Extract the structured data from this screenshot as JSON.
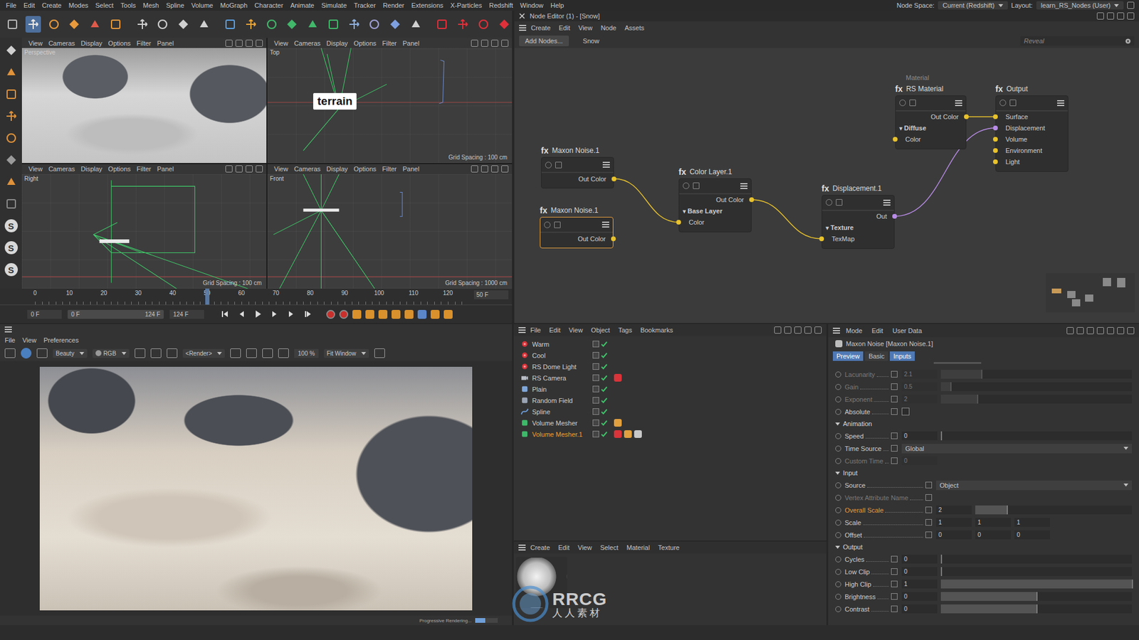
{
  "menubar": {
    "items": [
      "File",
      "Edit",
      "Create",
      "Modes",
      "Select",
      "Tools",
      "Mesh",
      "Spline",
      "Volume",
      "MoGraph",
      "Character",
      "Animate",
      "Simulate",
      "Tracker",
      "Render",
      "Extensions",
      "X-Particles",
      "Redshift",
      "Window",
      "Help"
    ],
    "node_space_label": "Node Space:",
    "node_space": "Current (Redshift)",
    "layout_label": "Layout:",
    "layout": "learn_RS_Nodes (User)"
  },
  "toolbar": {
    "tools": [
      {
        "selected": false
      },
      {
        "selected": true
      },
      {
        "selected": false
      },
      {
        "selected": false
      },
      {
        "selected": false
      },
      {
        "selected": false
      },
      {
        "selected": false
      },
      {
        "selected": false
      },
      {
        "selected": false
      },
      {
        "selected": false
      },
      {
        "selected": false
      },
      {
        "selected": false
      },
      {
        "selected": false
      },
      {
        "selected": false
      },
      {
        "selected": false
      },
      {
        "selected": false
      },
      {
        "selected": false
      },
      {
        "selected": false
      },
      {
        "selected": false
      },
      {
        "selected": false
      },
      {
        "selected": false
      },
      {
        "selected": false
      },
      {
        "selected": false
      },
      {
        "selected": false
      }
    ]
  },
  "side_tools": [
    {
      "kind": "icon",
      "selected": false
    },
    {
      "kind": "icon",
      "selected": false
    },
    {
      "kind": "icon",
      "selected": false
    },
    {
      "kind": "icon",
      "selected": false
    },
    {
      "kind": "icon",
      "selected": false
    },
    {
      "kind": "icon",
      "selected": false
    },
    {
      "kind": "icon",
      "selected": false
    },
    {
      "kind": "icon",
      "selected": false
    },
    {
      "kind": "letter",
      "glyph": "S",
      "selected": false
    },
    {
      "kind": "letter",
      "glyph": "S",
      "selected": false
    },
    {
      "kind": "letter",
      "glyph": "S",
      "selected": false
    }
  ],
  "viewport_menu": [
    "View",
    "Cameras",
    "Display",
    "Options",
    "Filter",
    "Panel"
  ],
  "viewports": [
    {
      "name": "Perspective",
      "shading": "rendered"
    },
    {
      "name": "Top",
      "shading": "wire",
      "grid": "Grid Spacing : 100 cm",
      "tag": "terrain"
    },
    {
      "name": "Right",
      "shading": "wire",
      "grid": "Grid Spacing : 100 cm"
    },
    {
      "name": "Front",
      "shading": "wire",
      "grid": "Grid Spacing : 1000 cm"
    }
  ],
  "timeline": {
    "ticks": [
      "0",
      "10",
      "20",
      "30",
      "40",
      "50",
      "60",
      "70",
      "80",
      "90",
      "100",
      "110",
      "120"
    ],
    "frame": "50 F",
    "level": 0.403,
    "fields": [
      "0 F",
      "0 F",
      "124 F",
      "124 F"
    ]
  },
  "node_editor": {
    "title": "Node Editor (1) - [Snow]",
    "menu": [
      "Create",
      "Edit",
      "View",
      "Node",
      "Assets"
    ],
    "add_button": "Add Nodes...",
    "graph": "Snow",
    "search_placeholder": "Reveal",
    "nodes": [
      {
        "badge": "fx",
        "title": "Maxon Noise.1",
        "selected": false,
        "rows": [
          {
            "kind": "output",
            "name": "Out Color",
            "color": "#e8c22c"
          }
        ]
      },
      {
        "badge": "fx",
        "title": "Maxon Noise.1",
        "selected": true,
        "rows": [
          {
            "kind": "output",
            "name": "Out Color",
            "color": "#e8c22c"
          }
        ]
      },
      {
        "badge": "fx",
        "title": "Color Layer.1",
        "selected": false,
        "rows": [
          {
            "kind": "output",
            "name": "Out Color",
            "color": "#e8c22c"
          },
          {
            "kind": "group",
            "name": "Base Layer",
            "toggle": "▾",
            "expanded": true
          },
          {
            "kind": "input",
            "name": "Color",
            "color": "#e8c22c"
          }
        ]
      },
      {
        "badge": "fx",
        "title": "Displacement.1",
        "selected": false,
        "rows": [
          {
            "kind": "output",
            "name": "Out",
            "color": "#b88ce6"
          },
          {
            "kind": "group",
            "name": "Texture",
            "toggle": "▾",
            "expanded": true
          },
          {
            "kind": "input",
            "name": "TexMap",
            "color": "#e8c22c"
          }
        ]
      },
      {
        "badge": "fx",
        "title": "RS Material",
        "caption": "Material",
        "selected": false,
        "rows": [
          {
            "kind": "output",
            "name": "Out Color",
            "color": "#e8c22c"
          },
          {
            "kind": "group",
            "name": "Diffuse",
            "toggle": "▾",
            "expanded": true
          },
          {
            "kind": "input",
            "name": "Color",
            "color": "#e8c22c"
          }
        ]
      },
      {
        "badge": "fx",
        "title": "Output",
        "selected": false,
        "rows": [
          {
            "kind": "input",
            "name": "Surface",
            "color": "#e8c22c"
          },
          {
            "kind": "input",
            "name": "Displacement",
            "color": "#b88ce6"
          },
          {
            "kind": "input",
            "name": "Volume",
            "color": "#e8c22c"
          },
          {
            "kind": "input",
            "name": "Environment",
            "color": "#e8c22c"
          },
          {
            "kind": "input",
            "name": "Light",
            "color": "#e8c22c"
          }
        ]
      }
    ]
  },
  "render_view": {
    "menu": [
      "File",
      "View",
      "Preferences"
    ],
    "toolbar": [
      "Beauty",
      "RGB",
      "<Render>",
      "100 %",
      "Fit Window"
    ],
    "progress_label": "Progressive Rendering...",
    "progress": 0.45
  },
  "object_manager": {
    "menu": [
      "File",
      "Edit",
      "View",
      "Object",
      "Tags",
      "Bookmarks"
    ],
    "objects": [
      {
        "name": "Warm",
        "color": "#d8343a",
        "selected": false,
        "enabled": true,
        "tags": []
      },
      {
        "name": "Cool",
        "color": "#d8343a",
        "selected": false,
        "enabled": true,
        "tags": []
      },
      {
        "name": "RS Dome Light",
        "color": "#d8343a",
        "selected": false,
        "enabled": true,
        "tags": []
      },
      {
        "name": "RS Camera",
        "color": "#b8bcc4",
        "selected": false,
        "enabled": true,
        "tags": [
          {
            "color": "#d8343a"
          }
        ]
      },
      {
        "name": "Plain",
        "color": "#7fa6d8",
        "selected": false,
        "enabled": true,
        "tags": []
      },
      {
        "name": "Random Field",
        "color": "#9aa4b4",
        "selected": false,
        "enabled": true,
        "tags": []
      },
      {
        "name": "Spline",
        "color": "#6f9fe0",
        "selected": false,
        "enabled": true,
        "tags": []
      },
      {
        "name": "Volume Mesher",
        "color": "#3fb86a",
        "selected": false,
        "enabled": true,
        "tags": [
          {
            "color": "#e0a040"
          }
        ]
      },
      {
        "name": "Volume Mesher.1",
        "color": "#3fb86a",
        "selected": true,
        "enabled": true,
        "tags": [
          {
            "color": "#d8343a"
          },
          {
            "color": "#e0a040"
          },
          {
            "color": "#c8c8c8"
          }
        ]
      }
    ]
  },
  "material_manager": {
    "menu": [
      "Create",
      "Edit",
      "View",
      "Select",
      "Material",
      "Texture"
    ],
    "materials": [
      {
        "selected": false
      }
    ]
  },
  "attribute_manager": {
    "menu": [
      "Mode",
      "Edit",
      "User Data"
    ],
    "title": "Maxon Noise [Maxon Noise.1]",
    "tabs": [
      {
        "label": "Preview",
        "selected": true
      },
      {
        "label": "Basic",
        "selected": false
      },
      {
        "label": "Inputs",
        "selected": true
      }
    ],
    "top_fields": [
      {
        "label": "Lacunarity",
        "kind": "slider",
        "value": "2.1",
        "level": 0.21,
        "disabled": true,
        "changed": false
      },
      {
        "label": "Gain",
        "kind": "slider",
        "value": "0.5",
        "level": 0.05,
        "disabled": true,
        "changed": false
      },
      {
        "label": "Exponent",
        "kind": "slider",
        "value": "2",
        "level": 0.19,
        "disabled": true,
        "changed": false
      },
      {
        "label": "Absolute",
        "kind": "checkbox",
        "checked": false,
        "disabled": false,
        "changed": false
      }
    ],
    "sections": [
      {
        "title": "Animation",
        "expanded": true,
        "fields": [
          {
            "label": "Speed",
            "kind": "slider",
            "value": "0",
            "level": 0,
            "disabled": false,
            "changed": false
          },
          {
            "label": "Time Source",
            "kind": "dropdown",
            "value": "Global",
            "disabled": false,
            "changed": false
          },
          {
            "label": "Custom Time",
            "kind": "number",
            "value": "0",
            "disabled": true,
            "changed": false
          }
        ]
      },
      {
        "title": "Input",
        "expanded": true,
        "fields": [
          {
            "label": "Source",
            "kind": "dropdown",
            "value": "Object",
            "disabled": false,
            "changed": false
          },
          {
            "label": "Vertex Attribute Name",
            "kind": "text",
            "disabled": true,
            "changed": false
          },
          {
            "label": "Overall Scale",
            "kind": "slider",
            "value": "2",
            "level": 0.2,
            "disabled": false,
            "changed": true
          },
          {
            "label": "Scale",
            "kind": "vector",
            "values": [
              "1",
              "1",
              "1"
            ],
            "disabled": false,
            "changed": false
          },
          {
            "label": "Offset",
            "kind": "vector",
            "values": [
              "0",
              "0",
              "0"
            ],
            "disabled": false,
            "changed": false
          }
        ]
      },
      {
        "title": "Output",
        "expanded": true,
        "fields": [
          {
            "label": "Cycles",
            "kind": "slider",
            "value": "0",
            "level": 0,
            "disabled": false,
            "changed": false
          },
          {
            "label": "Low Clip",
            "kind": "slider",
            "value": "0",
            "level": 0,
            "disabled": false,
            "changed": false
          },
          {
            "label": "High Clip",
            "kind": "slider",
            "value": "1",
            "level": 1,
            "disabled": false,
            "changed": false
          },
          {
            "label": "Brightness",
            "kind": "slider",
            "value": "0",
            "level": 0.5,
            "disabled": false,
            "changed": false
          },
          {
            "label": "Contrast",
            "kind": "slider",
            "value": "0",
            "level": 0.5,
            "disabled": false,
            "changed": false
          }
        ]
      }
    ]
  },
  "watermark": {
    "logo": "RRCG",
    "caption": "人人素材"
  }
}
